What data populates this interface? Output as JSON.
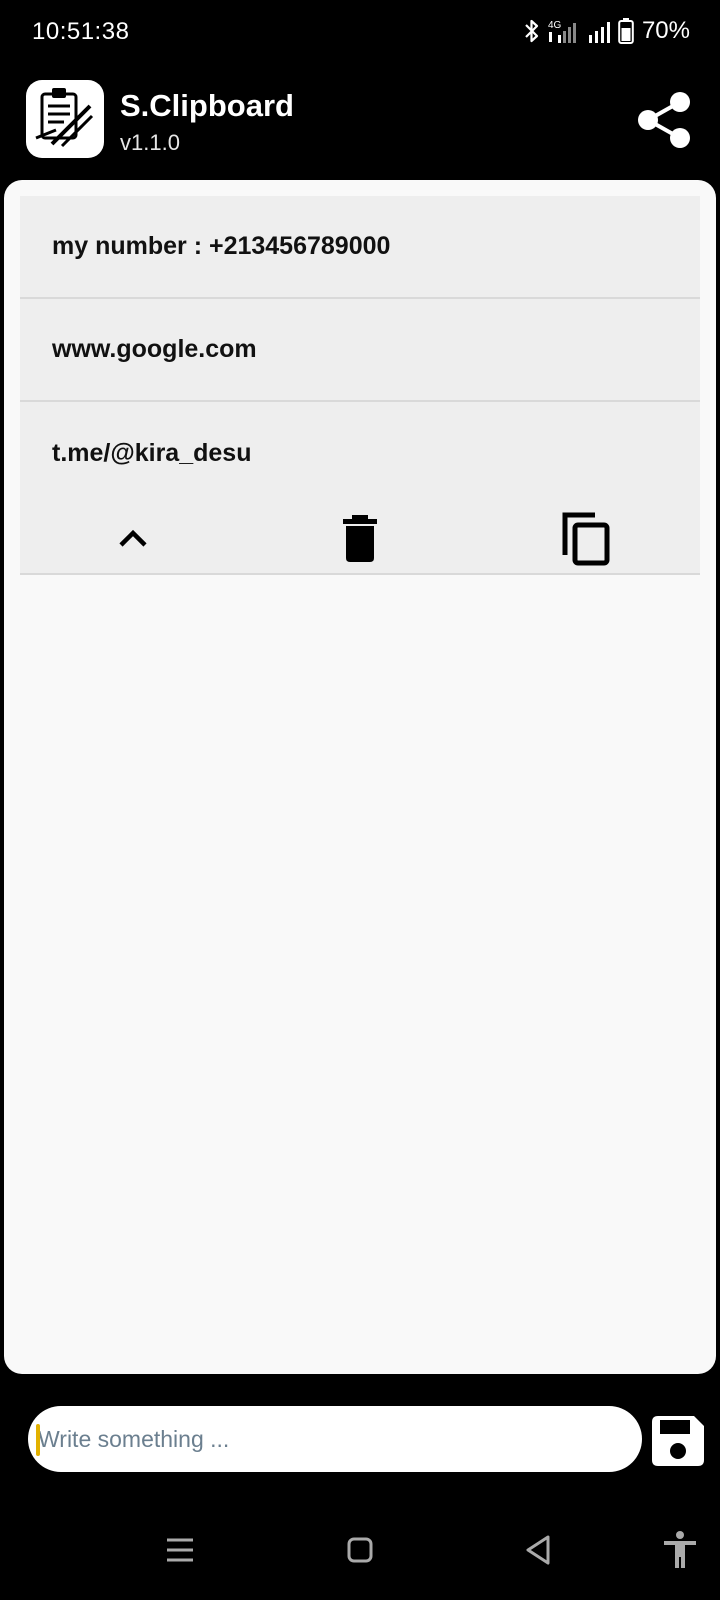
{
  "status_bar": {
    "time": "10:51:38",
    "network": "4G",
    "battery": "70%",
    "icons": [
      "bluetooth-icon",
      "signal-4g-icon",
      "signal-icon",
      "battery-icon"
    ]
  },
  "app": {
    "title": "S.Clipboard",
    "version": "v1.1.0",
    "icons": [
      "app-logo-icon",
      "share-icon"
    ]
  },
  "clips": [
    {
      "text": "my number : +213456789000"
    },
    {
      "text": "www.google.com"
    },
    {
      "text": "t.me/@kira_desu",
      "expanded": true
    }
  ],
  "clip_actions": [
    "chevron-up-icon",
    "trash-icon",
    "copy-icon"
  ],
  "input": {
    "placeholder": "Write something ...",
    "value": ""
  },
  "nav": [
    "menu-icon",
    "home-icon",
    "back-icon",
    "accessibility-icon"
  ],
  "colors": {
    "background": "#000000",
    "panel": "#f9f9f9",
    "item": "#eeeeee",
    "caret": "#e2b100"
  }
}
